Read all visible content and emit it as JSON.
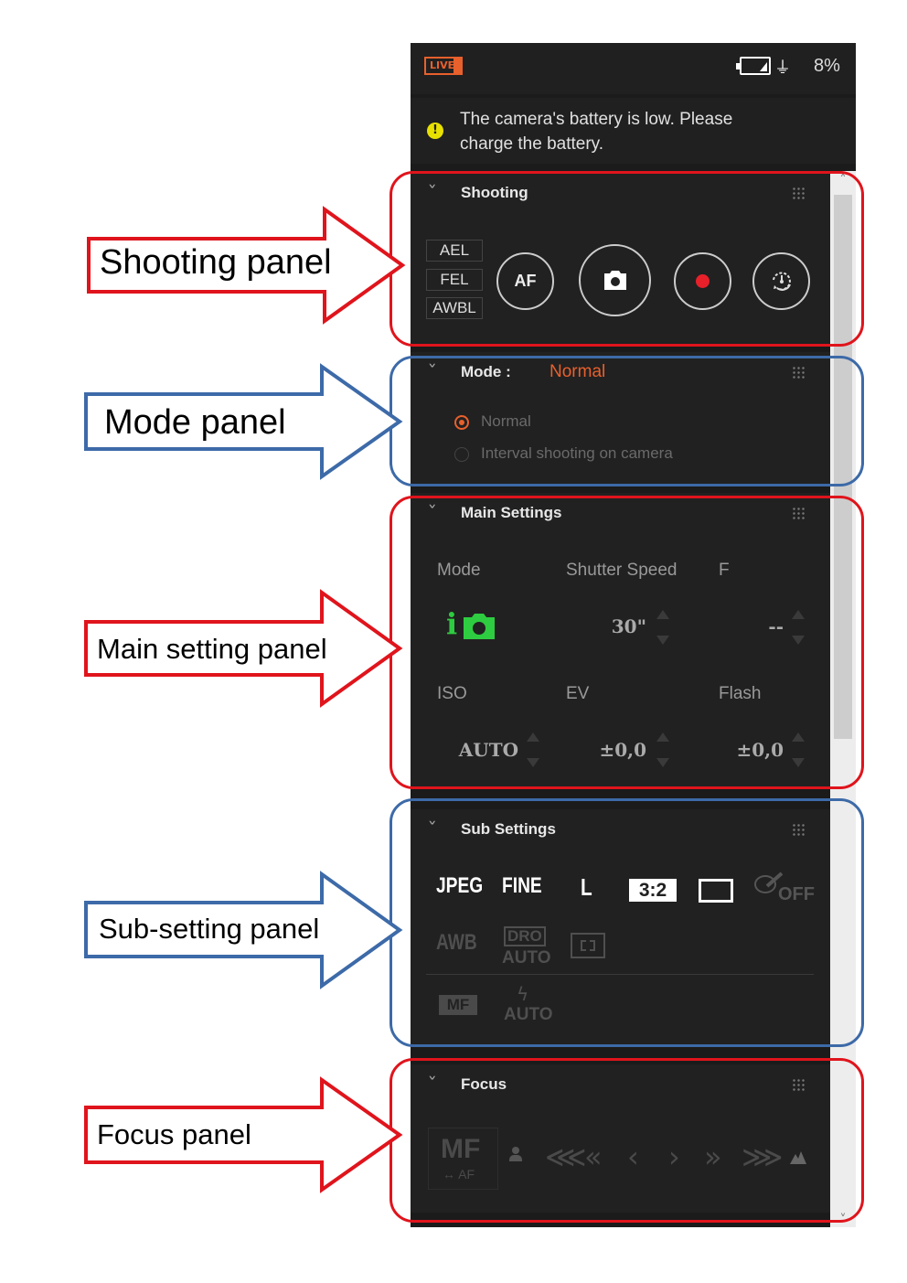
{
  "topbar": {
    "live_label": "LIVE",
    "battery_percent": "8%"
  },
  "warning": {
    "text": "The camera's battery is low. Please charge the battery."
  },
  "shooting": {
    "title": "Shooting",
    "lock_buttons": [
      "AEL",
      "FEL",
      "AWBL"
    ],
    "af_label": "AF"
  },
  "mode": {
    "title": "Mode :",
    "current": "Normal",
    "options": [
      {
        "label": "Normal",
        "selected": true
      },
      {
        "label": "Interval shooting on camera",
        "selected": false
      }
    ]
  },
  "main_settings": {
    "title": "Main Settings",
    "labels": {
      "mode": "Mode",
      "shutter": "Shutter Speed",
      "f": "F",
      "iso": "ISO",
      "ev": "EV",
      "flash": "Flash"
    },
    "values": {
      "shutter": "30\"",
      "f": "--",
      "iso": "AUTO",
      "ev": "±0,0",
      "flash": "±0,0"
    },
    "mode_icon_text": "i"
  },
  "sub_settings": {
    "title": "Sub Settings",
    "row1": [
      "JPEG",
      "FINE",
      "L",
      "3:2"
    ],
    "off_label": "OFF",
    "awb": "AWB",
    "dro_top": "DRO",
    "dro_bottom": "AUTO",
    "mf": "MF",
    "flash_mode": "AUTO"
  },
  "focus": {
    "title": "Focus",
    "mf_label": "MF",
    "af_label": "↔ AF"
  },
  "annotations": {
    "shooting": "Shooting panel",
    "mode": "Mode panel",
    "main": "Main setting panel",
    "sub": "Sub-setting panel",
    "focus": "Focus panel"
  },
  "colors": {
    "accent": "#e8602c",
    "record": "#e8202a",
    "mode_icon": "#2ecc40",
    "red_annot": "#e0141c",
    "blue_annot": "#3d6aa8"
  }
}
